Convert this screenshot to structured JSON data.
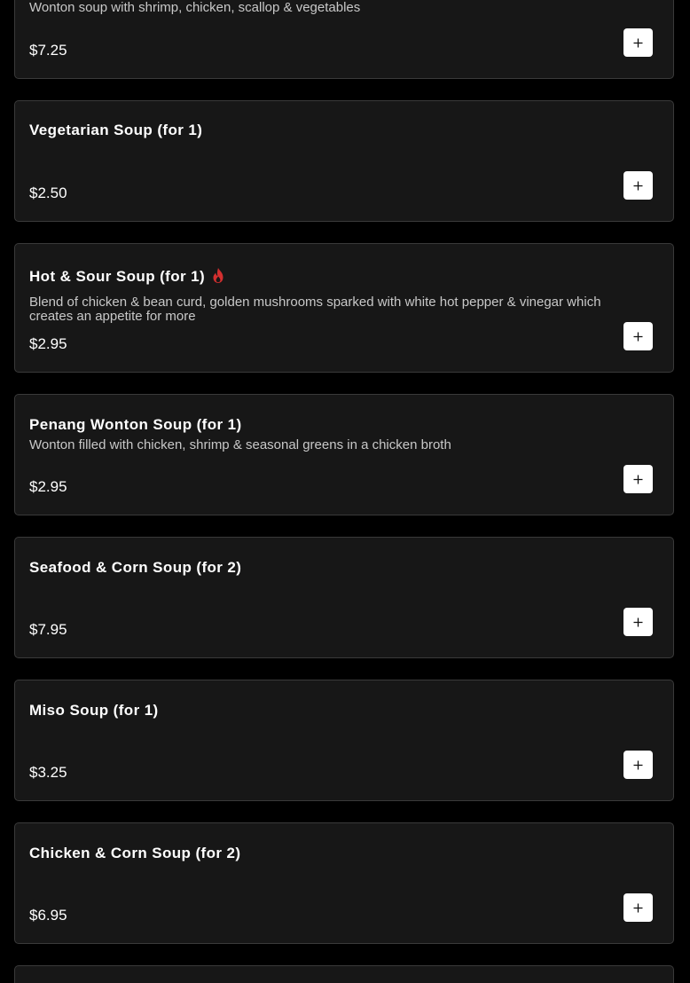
{
  "menu": {
    "items": [
      {
        "name": "",
        "description": "Wonton soup with shrimp, chicken, scallop & vegetables",
        "price": "$7.25",
        "spicy": false
      },
      {
        "name": "Vegetarian Soup (for 1)",
        "description": "",
        "price": "$2.50",
        "spicy": false
      },
      {
        "name": "Hot & Sour Soup (for 1)",
        "description": "Blend of chicken & bean curd, golden mushrooms sparked with white hot pepper & vinegar which creates an appetite for more",
        "price": "$2.95",
        "spicy": true
      },
      {
        "name": "Penang Wonton Soup (for 1)",
        "description": "Wonton filled with chicken, shrimp & seasonal greens in a chicken broth",
        "price": "$2.95",
        "spicy": false
      },
      {
        "name": "Seafood & Corn Soup (for 2)",
        "description": "",
        "price": "$7.95",
        "spicy": false
      },
      {
        "name": "Miso Soup (for 1)",
        "description": "",
        "price": "$3.25",
        "spicy": false
      },
      {
        "name": "Chicken & Corn Soup (for 2)",
        "description": "",
        "price": "$6.95",
        "spicy": false
      },
      {
        "name": "",
        "description": "",
        "price": "",
        "spicy": false
      }
    ]
  },
  "icons": {
    "add": "plus-icon",
    "spicy": "flame-icon"
  },
  "colors": {
    "page_background": "#000000",
    "card_background": "#171717",
    "card_border": "#3a3a3a",
    "spicy_icon": "#d32f2f",
    "button_background": "#ffffff"
  }
}
